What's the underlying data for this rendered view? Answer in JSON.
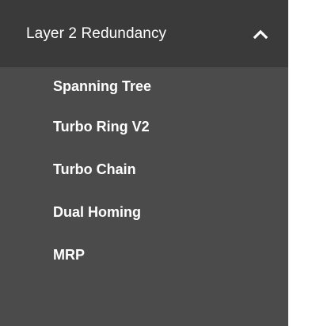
{
  "menu": {
    "header": {
      "label": "Layer 2 Redundancy",
      "icon": "chevron-up-icon"
    },
    "items": [
      {
        "label": "Spanning Tree"
      },
      {
        "label": "Turbo Ring V2"
      },
      {
        "label": "Turbo Chain"
      },
      {
        "label": "Dual Homing"
      },
      {
        "label": "MRP"
      }
    ]
  },
  "colors": {
    "header_bg": "#3a3a3a",
    "menu_bg": "#4b4b4b",
    "text": "#ffffff"
  }
}
